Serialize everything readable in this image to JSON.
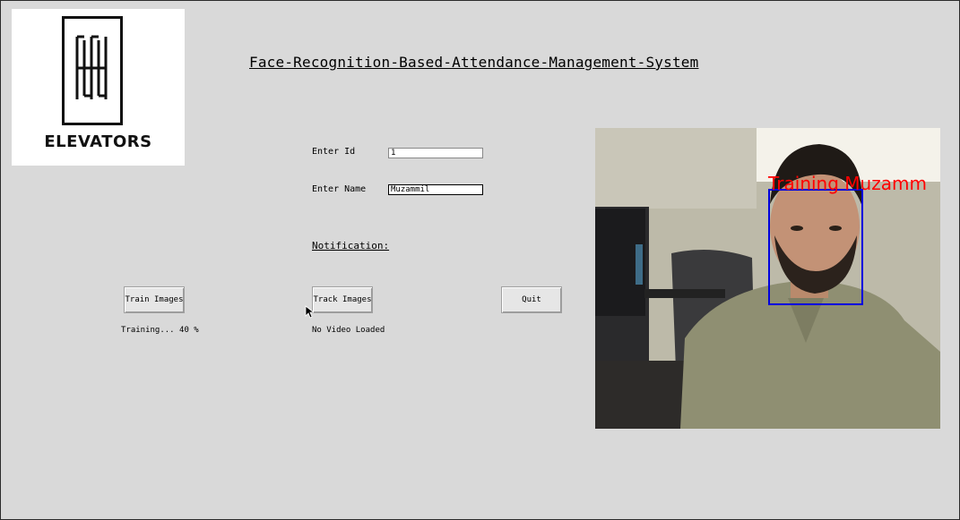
{
  "logo": {
    "text": "ELEVATORS"
  },
  "header": {
    "title": "Face-Recognition-Based-Attendance-Management-System"
  },
  "form": {
    "id_label": "Enter Id",
    "id_value": "1",
    "name_label": "Enter Name",
    "name_value": "Muzammil"
  },
  "notification": {
    "label": "Notification:"
  },
  "buttons": {
    "train": "Train Images",
    "track": "Track Images",
    "quit": "Quit"
  },
  "status": {
    "training": "Training... 40 %",
    "video": "No Video Loaded"
  },
  "video": {
    "overlay_text": "Training Muzamm",
    "overlay_color": "#ff0000",
    "box_color": "#0000dd"
  }
}
